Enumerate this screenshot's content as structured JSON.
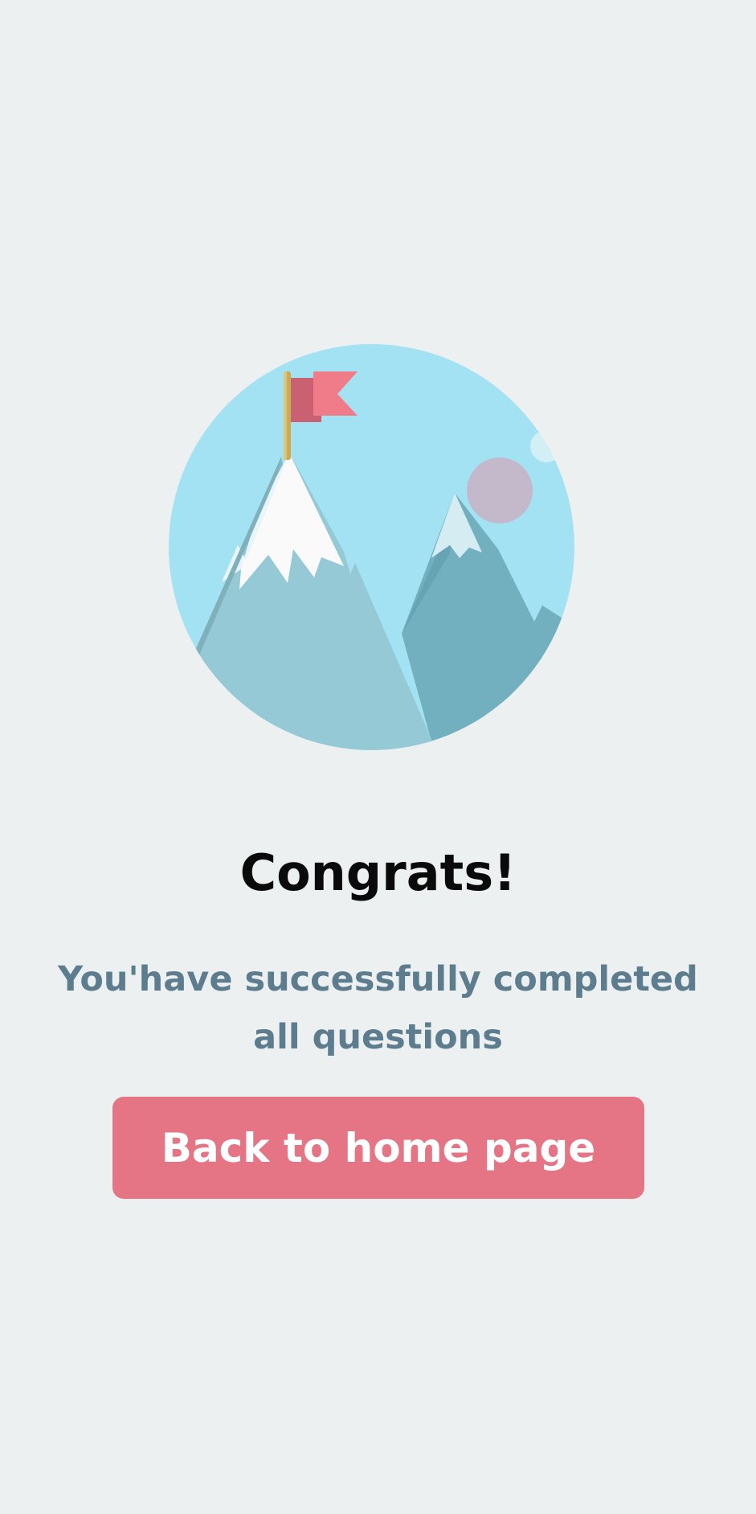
{
  "congrats": {
    "title": "Congrats!",
    "message": "You'have successfully completed all questions",
    "button_label": "Back to home page"
  },
  "illustration": {
    "icon": "mountain-summit-flag-illustration",
    "sky_color": "#a3e2f2",
    "flag_color": "#f07b89",
    "button_color": "#e57585"
  }
}
